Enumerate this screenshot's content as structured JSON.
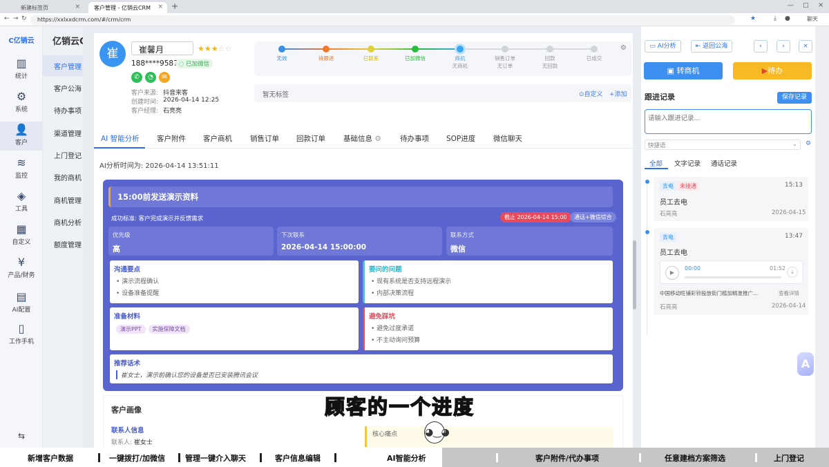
{
  "browser": {
    "tabs": [
      {
        "label": "新建标签页"
      },
      {
        "label": "客户管理 - 亿销云CRM"
      }
    ],
    "url": "https://xxlxxdcrm.com/#/crm/crm",
    "profile_label": "聊天"
  },
  "app": {
    "logo": "C亿销云",
    "brand": "亿销云C"
  },
  "nav_primary": [
    {
      "label": "统计",
      "icon": "bar-chart-icon"
    },
    {
      "label": "系统",
      "icon": "gear-icon"
    },
    {
      "label": "客户",
      "icon": "user-icon"
    },
    {
      "label": "监控",
      "icon": "layers-icon"
    },
    {
      "label": "工具",
      "icon": "cube-icon"
    },
    {
      "label": "自定义",
      "icon": "grid-icon"
    },
    {
      "label": "产品/财务",
      "icon": "yen-icon"
    },
    {
      "label": "AI配置",
      "icon": "ai-config-icon"
    },
    {
      "label": "工作手机",
      "icon": "phone-icon"
    }
  ],
  "nav_secondary": [
    "客户管理",
    "客户公海",
    "待办事项",
    "渠道管理",
    "上门登记",
    "我的商机",
    "商机管理",
    "商机分析",
    "额度管理"
  ],
  "customer": {
    "avatar": "崔",
    "name": "崔馨月",
    "phone": "188****9587",
    "wechat_badge": "已加微信",
    "rating": 3,
    "rating_max": 5,
    "source_label": "客户来源:",
    "source": "抖音来客",
    "created_label": "创建时间:",
    "created": "2026-04-14 12:25",
    "manager_label": "客户经理:",
    "manager": "石亮亮"
  },
  "pipeline": [
    {
      "name": "无效",
      "sub": "",
      "color": "#3a8ee6"
    },
    {
      "name": "待跟进",
      "sub": "",
      "color": "#f07a2a"
    },
    {
      "name": "已联系",
      "sub": "",
      "color": "#e0d03a"
    },
    {
      "name": "已加微信",
      "sub": "",
      "color": "#2dbb3b"
    },
    {
      "name": "商机",
      "sub": "无商机",
      "color": "#3aa7f0"
    },
    {
      "name": "销售订单",
      "sub": "无订单",
      "color": "#cfd3da"
    },
    {
      "name": "回款",
      "sub": "无回款",
      "color": "#cfd3da"
    },
    {
      "name": "已成交",
      "sub": "",
      "color": "#cfd3da"
    }
  ],
  "tags": {
    "empty": "暂无标签",
    "custom": "自定义",
    "add": "添加"
  },
  "main_tabs": [
    "AI 智能分析",
    "客户附件",
    "客户商机",
    "销售订单",
    "回款订单",
    "基础信息",
    "待办事项",
    "SOP进度",
    "微信聊天"
  ],
  "ai": {
    "time_label": "AI分析时间为:",
    "time": "2026-04-14 13:51:11",
    "headline": "15:00前发送演示资料",
    "success": "成功标准: 客户完成演示并反馈需求",
    "deadline": "截止 2026-04-14 15:00",
    "channel": "通话+微信综合",
    "priority_label": "优先级",
    "priority": "高",
    "next_label": "下次联系",
    "next": "2026-04-14 15:00:00",
    "method_label": "联系方式",
    "method": "微信",
    "points_title": "沟通要点",
    "points": [
      "演示流程确认",
      "设备准备提醒"
    ],
    "ask_title": "要问的问题",
    "ask": [
      "现有系统是否支持远程演示",
      "内部决策流程"
    ],
    "prep_title": "准备材料",
    "prep": [
      "演示PPT",
      "实施保障文档"
    ],
    "avoid_title": "避免踩坑",
    "avoid": [
      "避免过度承诺",
      "不主动询问预算"
    ],
    "script_title": "推荐话术",
    "script": "崔女士，演示前确认您的设备是否已安装腾讯会议"
  },
  "portrait": {
    "title": "客户画像",
    "contact_title": "联系人信息",
    "contact_label": "联系人:",
    "contact": "崔女士",
    "pain_title": "核心痛点"
  },
  "right": {
    "ai_btn": "AI分析",
    "back_btn": "返回公海",
    "convert": "转商机",
    "todo": "待办",
    "follow_title": "跟进记录",
    "save": "保存记录",
    "placeholder": "请输入跟进记录...",
    "quick": "快捷语",
    "tabs": [
      "全部",
      "文字记录",
      "通话记录"
    ],
    "records": [
      {
        "type": "去电",
        "status": "未接通",
        "time": "15:13",
        "text": "员工去电",
        "user": "石亮亮",
        "date": "2026-04-15"
      },
      {
        "type": "去电",
        "status": "",
        "time": "13:47",
        "text": "员工去电",
        "audio_start": "00:00",
        "audio_end": "01:52",
        "summary": "中国移动旺铺彩铃投放街门槛加精准推广...",
        "detail": "查看详情",
        "user": "石亮亮",
        "date": "2026-04-14"
      }
    ]
  },
  "subtitle": "顾客的一个进度",
  "captions": [
    "新增客户数据",
    "一键拨打/加微信",
    "管理一键介入聊天",
    "客户信息编辑",
    "AI智能分析",
    "客户附件/代办事项",
    "任意建档方案筛选",
    "上门登记"
  ]
}
